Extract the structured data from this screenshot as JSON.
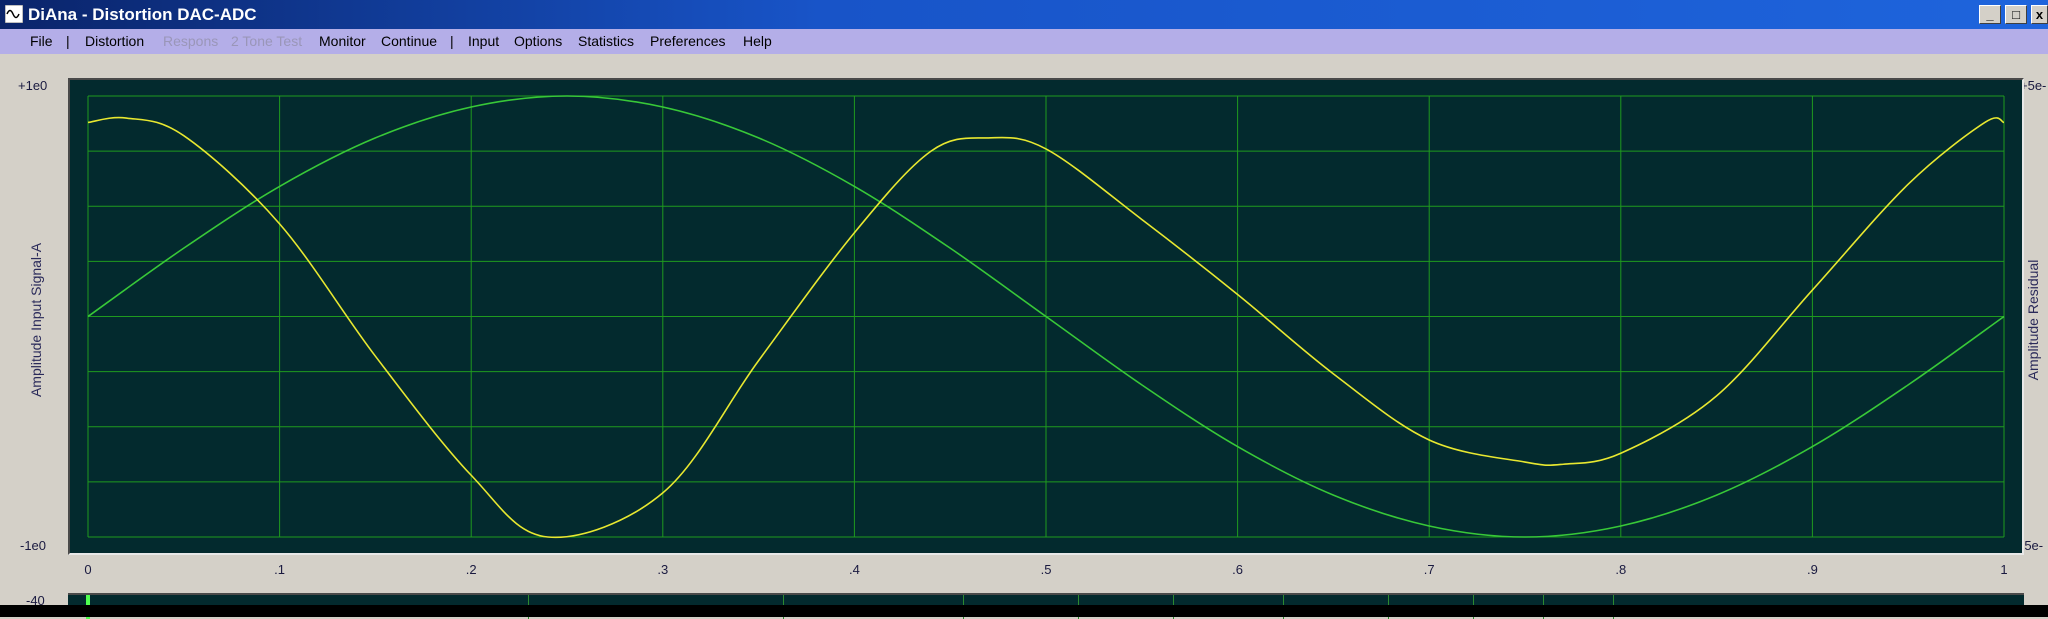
{
  "window": {
    "title": "DiAna - Distortion DAC-ADC",
    "minimize_label": "_",
    "maximize_label": "□",
    "close_label": "x"
  },
  "menu": {
    "items": [
      {
        "label": "File",
        "enabled": true
      },
      {
        "label": "|",
        "separator": true
      },
      {
        "label": "Distortion",
        "enabled": true
      },
      {
        "label": "Respons",
        "enabled": false
      },
      {
        "label": "2 Tone Test",
        "enabled": false
      },
      {
        "label": "Monitor",
        "enabled": true
      },
      {
        "label": "Continue",
        "enabled": true
      },
      {
        "label": "|",
        "separator": true
      },
      {
        "label": "Input",
        "enabled": true
      },
      {
        "label": "Options",
        "enabled": true
      },
      {
        "label": "Statistics",
        "enabled": true
      },
      {
        "label": "Preferences",
        "enabled": true
      },
      {
        "label": "Help",
        "enabled": true
      }
    ]
  },
  "plot": {
    "y_left_label": "Amplitude Input Signal-A",
    "y_right_label": "Amplitude Residual",
    "y_left_top": "+1e0",
    "y_left_bottom": "-1e0",
    "y_right_top": "+5e-",
    "y_right_bottom": "-5e-",
    "bottom_panel_top_label": "-40",
    "colors": {
      "background": "#032a2e",
      "grid": "#1f9a1f",
      "signal": "#38c838",
      "residual": "#e8e830"
    }
  },
  "chart_data": {
    "type": "line",
    "x_ticks": [
      "0",
      ".1",
      ".2",
      ".3",
      ".4",
      ".5",
      ".6",
      ".7",
      ".8",
      ".9",
      "1"
    ],
    "xlim": [
      0,
      1
    ],
    "ylim": [
      -1,
      1
    ],
    "grid": true,
    "series": [
      {
        "color": "#38c838",
        "x": [
          0,
          0.05,
          0.1,
          0.15,
          0.2,
          0.25,
          0.3,
          0.35,
          0.4,
          0.45,
          0.5,
          0.55,
          0.6,
          0.65,
          0.7,
          0.75,
          0.8,
          0.85,
          0.9,
          0.95,
          1
        ],
        "y": [
          0,
          0.31,
          0.59,
          0.81,
          0.95,
          1.0,
          0.95,
          0.81,
          0.59,
          0.31,
          0,
          -0.31,
          -0.59,
          -0.81,
          -0.95,
          -1.0,
          -0.95,
          -0.81,
          -0.59,
          -0.31,
          0
        ]
      },
      {
        "color": "#e8e830",
        "x": [
          0,
          0.02,
          0.05,
          0.1,
          0.15,
          0.2,
          0.24,
          0.3,
          0.35,
          0.4,
          0.44,
          0.47,
          0.5,
          0.55,
          0.6,
          0.65,
          0.7,
          0.75,
          0.77,
          0.8,
          0.85,
          0.9,
          0.95,
          0.99,
          1
        ],
        "y": [
          0.88,
          0.9,
          0.82,
          0.42,
          -0.18,
          -0.72,
          -1.0,
          -0.8,
          -0.2,
          0.38,
          0.75,
          0.81,
          0.76,
          0.44,
          0.1,
          -0.26,
          -0.56,
          -0.66,
          -0.67,
          -0.62,
          -0.36,
          0.12,
          0.6,
          0.88,
          0.88
        ]
      }
    ]
  }
}
